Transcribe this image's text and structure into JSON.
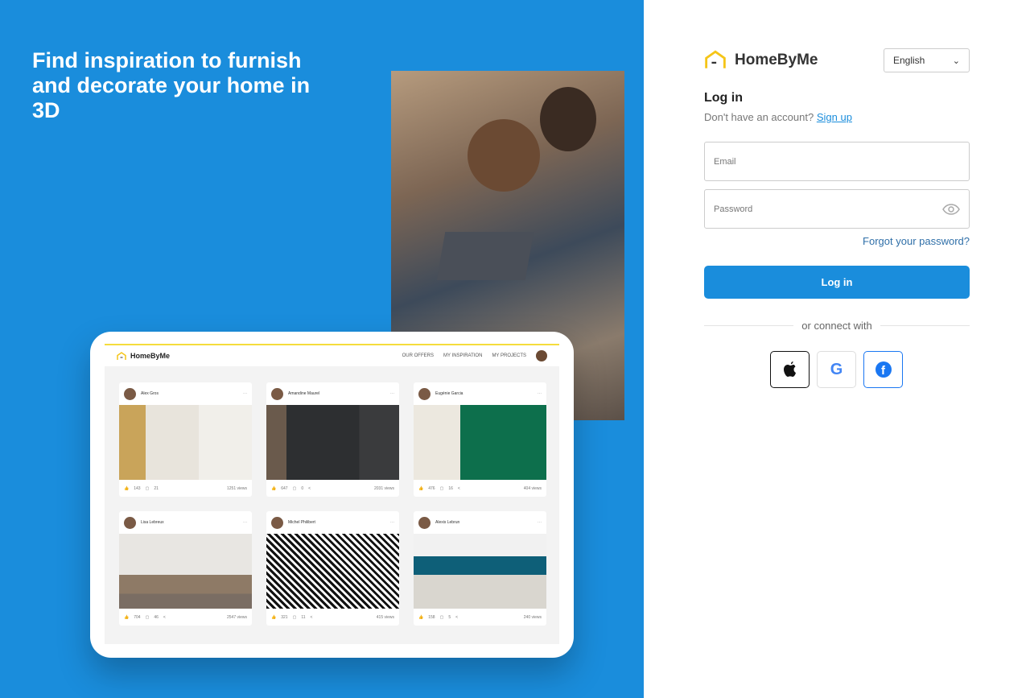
{
  "hero": {
    "headline": "Find inspiration to furnish and decorate your home in 3D"
  },
  "preview": {
    "brand": "HomeByMe",
    "nav": [
      "OUR OFFERS",
      "MY INSPIRATION",
      "MY PROJECTS"
    ],
    "cards": [
      {
        "author": "Alex Gros",
        "likes": "143",
        "comments": "21",
        "views": "1251 views",
        "bg": "linear-gradient(90deg,#c9a45a 0 20%,#e8e4dc 20% 60%,#f1efea 60%)"
      },
      {
        "author": "Amandine Maurel",
        "likes": "647",
        "comments": "0",
        "views": "2031 views",
        "bg": "linear-gradient(90deg,#6a5a4c 0 15%,#2d2f31 15% 70%,#3a3b3d 70%)"
      },
      {
        "author": "Eugénie Garcia",
        "likes": "476",
        "comments": "16",
        "views": "404 views",
        "bg": "linear-gradient(90deg,#ece8df 0 35%,#0d6f4c 35% 100%)"
      },
      {
        "author": "Lisa Lebreux",
        "likes": "704",
        "comments": "46",
        "views": "2547 views",
        "bg": "linear-gradient(180deg,#e8e6e2 0 55%,#8e7a66 55% 80%,#7a6d63 80%)"
      },
      {
        "author": "Michel Philibert",
        "likes": "321",
        "comments": "11",
        "views": "415 views",
        "bg": "repeating-linear-gradient(45deg,#111 0 3px,#fff 3px 6px)"
      },
      {
        "author": "Alexis Lebrun",
        "likes": "158",
        "comments": "5",
        "views": "240 views",
        "bg": "linear-gradient(180deg,#f1f1f1 0 30%,#0e5f78 30% 55%,#d9d6cf 55%)"
      }
    ]
  },
  "login": {
    "brand": "HomeByMe",
    "language": "English",
    "title": "Log in",
    "no_account": "Don't have an account?",
    "signup": "Sign up",
    "email_placeholder": "Email",
    "password_placeholder": "Password",
    "forgot": "Forgot your password?",
    "submit": "Log in",
    "or_connect": "or connect with"
  }
}
